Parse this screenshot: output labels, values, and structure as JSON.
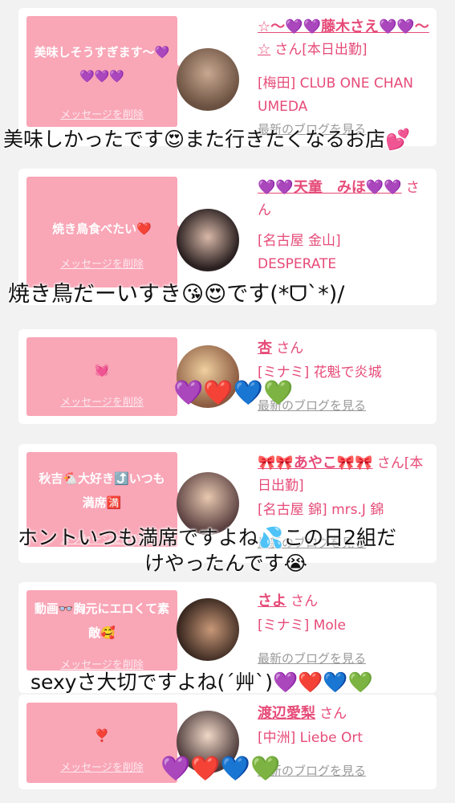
{
  "cards": [
    {
      "message": "美味しそうすぎます〜💜💜💜💜",
      "delete_label": "メッセージを削除",
      "name": "☆〜💜💜藤木さえ💜💜〜☆",
      "honorific": "さん[本日出勤]",
      "shop": "[梅田] CLUB ONE CHAN UMEDA",
      "blog_link": "最新のブログを見る"
    },
    {
      "message": "焼き鳥食べたい❤️",
      "delete_label": "メッセージを削除",
      "name": "💜💜天童　みほ💜💜",
      "honorific": "さん",
      "shop": "[名古屋 金山] DESPERATE",
      "blog_link": "最新のブログを見る"
    },
    {
      "message": "💓",
      "delete_label": "メッセージを削除",
      "name": "杏",
      "honorific": "さん",
      "shop": "[ミナミ] 花魁で炎城",
      "blog_link": "最新のブログを見る"
    },
    {
      "message": "秋吉🐔大好き⤴️いつも満席🈵",
      "delete_label": "メッセージを削除",
      "name": "🎀🎀あやこ🎀🎀",
      "honorific": "さん[本日出勤]",
      "shop": "[名古屋 錦] mrs.J 錦",
      "blog_link": "最新のブログを見る"
    },
    {
      "message": "動画👓胸元にエロくて素敵🥰",
      "delete_label": "メッセージを削除",
      "name": "さよ",
      "honorific": "さん",
      "shop": "[ミナミ] Mole",
      "blog_link": "最新のブログを見る"
    },
    {
      "message": "❣️",
      "delete_label": "メッセージを削除",
      "name": "渡辺愛梨",
      "honorific": "さん",
      "shop": "[中洲] Liebe Ort",
      "blog_link": "最新のブログを見る"
    }
  ],
  "overlays": {
    "line1": "美味しかったです😍また行きたくなるお店💕",
    "line2": "焼き鳥だーいすき😘😍です(*ᗜ`*)/",
    "line3a": "ホントいつも満席ですよね💦この日2組だ",
    "line3b": "けやったんです😭",
    "line4": "sexyさ大切ですよね(´艸`)💜❤️💙💚",
    "hearts_a": "💜❤️💙💚",
    "hearts_b": "💜❤️💙💚"
  },
  "colors": {
    "accent": "#e64b78",
    "bubble": "#f9a6b7",
    "background": "#f2f2f2"
  }
}
